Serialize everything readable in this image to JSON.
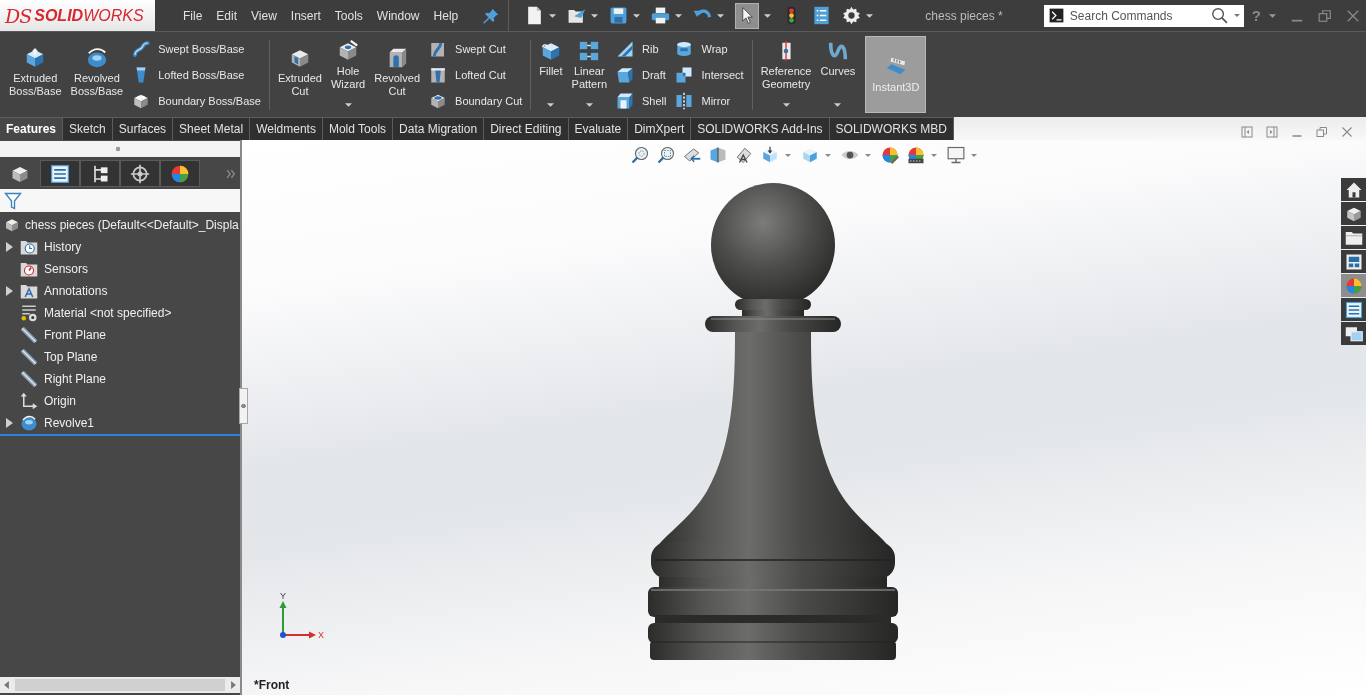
{
  "title_bar": {
    "logo_mark": "DS",
    "logo": "**SOLID**WORKS",
    "menu": [
      "File",
      "Edit",
      "View",
      "Insert",
      "Tools",
      "Window",
      "Help"
    ],
    "quick_access": [
      {
        "dropdown": true,
        "selected": false
      },
      {
        "dropdown": true,
        "selected": false
      },
      {
        "dropdown": true,
        "selected": false
      },
      {
        "dropdown": true,
        "selected": false
      },
      {
        "dropdown": true,
        "selected": false
      },
      {
        "dropdown": true,
        "selected": true
      },
      {
        "dropdown": false,
        "selected": false
      },
      {
        "dropdown": false,
        "selected": false
      },
      {
        "dropdown": true,
        "selected": false
      }
    ],
    "document_title": "chess pieces *",
    "search": {
      "placeholder": "Search Commands"
    },
    "help": "?"
  },
  "ribbon": {
    "groups": [
      {
        "columns": [
          {
            "kind": "large",
            "label": "Extruded Boss/Base",
            "dropdown": false,
            "selected": false
          },
          {
            "kind": "large",
            "label": "Revolved Boss/Base",
            "dropdown": false,
            "selected": false
          },
          {
            "kind": "stack",
            "items": [
              "Swept Boss/Base",
              "Lofted Boss/Base",
              "Boundary Boss/Base"
            ]
          }
        ]
      },
      {
        "columns": [
          {
            "kind": "large",
            "label": "Extruded Cut",
            "dropdown": false,
            "selected": false
          },
          {
            "kind": "large",
            "label": "Hole Wizard",
            "dropdown": true,
            "selected": false
          },
          {
            "kind": "large",
            "label": "Revolved Cut",
            "dropdown": false,
            "selected": false
          },
          {
            "kind": "stack",
            "items": [
              "Swept Cut",
              "Lofted Cut",
              "Boundary Cut"
            ]
          }
        ]
      },
      {
        "columns": [
          {
            "kind": "large",
            "label": "Fillet",
            "dropdown": true,
            "selected": false
          },
          {
            "kind": "large",
            "label": "Linear Pattern",
            "dropdown": true,
            "selected": false
          },
          {
            "kind": "stack",
            "items": [
              "Rib",
              "Draft",
              "Shell"
            ]
          },
          {
            "kind": "stack",
            "items": [
              "Wrap",
              "Intersect",
              "Mirror"
            ]
          }
        ]
      },
      {
        "columns": [
          {
            "kind": "large",
            "label": "Reference Geometry",
            "dropdown": true,
            "selected": false
          },
          {
            "kind": "large",
            "label": "Curves",
            "dropdown": true,
            "selected": false
          },
          {
            "kind": "large",
            "label": "Instant3D",
            "dropdown": false,
            "selected": true
          }
        ]
      }
    ]
  },
  "command_tabs": [
    {
      "label": "Features",
      "selected": true
    },
    {
      "label": "Sketch",
      "selected": false
    },
    {
      "label": "Surfaces",
      "selected": false
    },
    {
      "label": "Sheet Metal",
      "selected": false
    },
    {
      "label": "Weldments",
      "selected": false
    },
    {
      "label": "Mold Tools",
      "selected": false
    },
    {
      "label": "Data Migration",
      "selected": false
    },
    {
      "label": "Direct Editing",
      "selected": false
    },
    {
      "label": "Evaluate",
      "selected": false
    },
    {
      "label": "DimXpert",
      "selected": false
    },
    {
      "label": "SOLIDWORKS Add-Ins",
      "selected": false
    },
    {
      "label": "SOLIDWORKS MBD",
      "selected": false
    }
  ],
  "feature_manager": {
    "tabs": [
      {
        "selected": true
      },
      {
        "selected": false
      },
      {
        "selected": false
      },
      {
        "selected": false
      },
      {
        "selected": false
      }
    ],
    "root": "chess pieces (Default<<Default>_Displa",
    "items": [
      {
        "label": "History",
        "expandable": true,
        "expanded": false
      },
      {
        "label": "Sensors",
        "expandable": false,
        "expanded": false
      },
      {
        "label": "Annotations",
        "expandable": true,
        "expanded": false
      },
      {
        "label": "Material <not specified>",
        "expandable": false,
        "expanded": false
      },
      {
        "label": "Front Plane",
        "expandable": false,
        "expanded": false
      },
      {
        "label": "Top Plane",
        "expandable": false,
        "expanded": false
      },
      {
        "label": "Right Plane",
        "expandable": false,
        "expanded": false
      },
      {
        "label": "Origin",
        "expandable": false,
        "expanded": false
      },
      {
        "label": "Revolve1",
        "expandable": true,
        "expanded": false
      }
    ]
  },
  "viewport": {
    "heads_up_toolbar": [
      {
        "dropdown": false
      },
      {
        "dropdown": false
      },
      {
        "dropdown": false
      },
      {
        "dropdown": false
      },
      {
        "dropdown": false
      },
      {
        "dropdown": true
      },
      {
        "dropdown": true
      },
      {
        "dropdown": true
      },
      {
        "dropdown": false
      },
      {
        "dropdown": true
      },
      {
        "dropdown": true
      }
    ],
    "task_pane": [
      {
        "selected": false
      },
      {
        "selected": false
      },
      {
        "selected": false
      },
      {
        "selected": false
      },
      {
        "selected": true
      },
      {
        "selected": false
      },
      {
        "selected": false
      }
    ],
    "triad": {
      "x_label": "X",
      "y_label": "Y"
    },
    "view_name": "*Front"
  }
}
